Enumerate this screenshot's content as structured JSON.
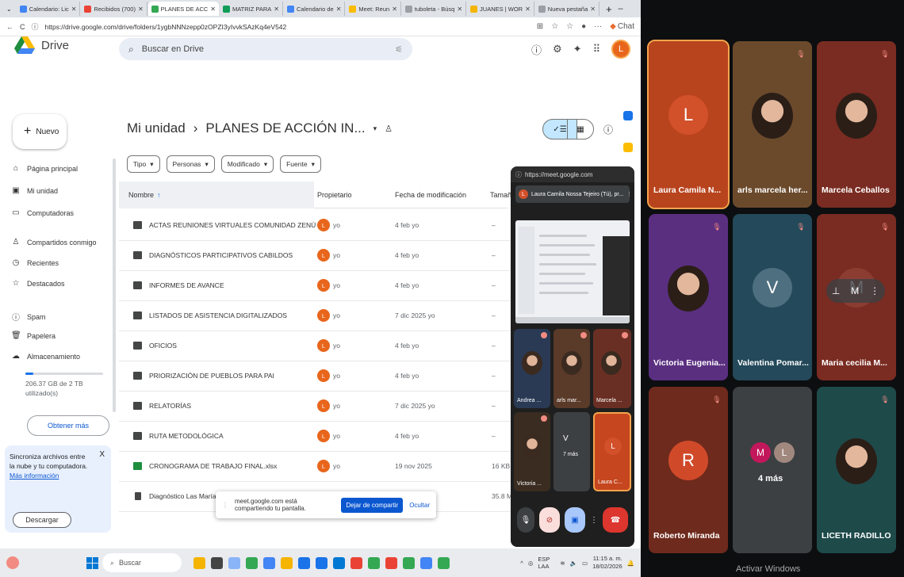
{
  "browser": {
    "tabs": [
      {
        "label": "Calendario: Lic",
        "color": "#4285f4"
      },
      {
        "label": "Recibidos (700)",
        "color": "#ea4335"
      },
      {
        "label": "PLANES DE ACC",
        "color": "#34a853",
        "active": true
      },
      {
        "label": "MATRIZ PARA",
        "color": "#0f9d58"
      },
      {
        "label": "Calendario de",
        "color": "#4285f4"
      },
      {
        "label": "Meet: Reun",
        "color": "#fbbc04"
      },
      {
        "label": "tuboleta - Búsq",
        "color": "#9aa0a6"
      },
      {
        "label": "JUANES | WOR",
        "color": "#f4b400"
      },
      {
        "label": "Nueva pestaña",
        "color": "#9aa0a6"
      }
    ],
    "new_tab": "+",
    "url": "https://drive.google.com/drive/folders/1ygbNNNzepp0zOPZI3yIvvkSAzKq4eV542",
    "chat_label": "Chat"
  },
  "drive": {
    "logo_text": "Drive",
    "search_placeholder": "Buscar en Drive",
    "new_button": "Nuevo",
    "sidebar": [
      {
        "label": "Página principal",
        "icon": "home-icon",
        "glyph": "⌂"
      },
      {
        "label": "Mi unidad",
        "icon": "drive-icon",
        "glyph": "▣"
      },
      {
        "label": "Computadoras",
        "icon": "computer-icon",
        "glyph": "▭"
      },
      {
        "label": "Compartidos conmigo",
        "icon": "shared-icon",
        "glyph": "♙"
      },
      {
        "label": "Recientes",
        "icon": "clock-icon",
        "glyph": "◷"
      },
      {
        "label": "Destacados",
        "icon": "star-icon",
        "glyph": "☆"
      },
      {
        "label": "Spam",
        "icon": "spam-icon",
        "glyph": "ⓘ"
      },
      {
        "label": "Papelera",
        "icon": "trash-icon",
        "glyph": "🗑"
      },
      {
        "label": "Almacenamiento",
        "icon": "cloud-icon",
        "glyph": "☁"
      }
    ],
    "storage_text": "206.37 GB de 2 TB utilizado(s)",
    "storage_fraction": 0.1,
    "obtener_mas": "Obtener más",
    "sync_card": {
      "text": "Sincroniza archivos entre la nube y tu computadora.",
      "more": "Más información",
      "download": "Descargar",
      "close": "X"
    },
    "breadcrumb": {
      "root": "Mi unidad",
      "separator": "›",
      "current": "PLANES DE ACCIÓN IN..."
    },
    "filters": [
      "Tipo",
      "Personas",
      "Modificado",
      "Fuente"
    ],
    "columns": {
      "name": "Nombre",
      "owner": "Propietario",
      "modified": "Fecha de modificación",
      "size": "Tamañ"
    },
    "rows": [
      {
        "name": "ACTAS REUNIONES VIRTUALES COMUNIDAD ZENÚ",
        "owner": "yo",
        "modified": "4 feb yo",
        "size": "–",
        "type": "folder"
      },
      {
        "name": "DIAGNÓSTICOS PARTICIPATIVOS CABILDOS",
        "owner": "yo",
        "modified": "4 feb yo",
        "size": "–",
        "type": "folder"
      },
      {
        "name": "INFORMES DE AVANCE",
        "owner": "yo",
        "modified": "4 feb yo",
        "size": "–",
        "type": "folder"
      },
      {
        "name": "LISTADOS DE ASISTENCIA DIGITALIZADOS",
        "owner": "yo",
        "modified": "7 dic 2025 yo",
        "size": "–",
        "type": "folder"
      },
      {
        "name": "OFICIOS",
        "owner": "yo",
        "modified": "4 feb yo",
        "size": "–",
        "type": "folder"
      },
      {
        "name": "PRIORIZACIÓN DE PUEBLOS PARA PAI",
        "owner": "yo",
        "modified": "4 feb yo",
        "size": "–",
        "type": "folder"
      },
      {
        "name": "RELATORÍAS",
        "owner": "yo",
        "modified": "7 dic 2025 yo",
        "size": "–",
        "type": "folder"
      },
      {
        "name": "RUTA METODOLÓGICA",
        "owner": "yo",
        "modified": "4 feb yo",
        "size": "–",
        "type": "folder"
      },
      {
        "name": "CRONOGRAMA DE TRABAJO FINAL.xlsx",
        "owner": "yo",
        "modified": "19 nov 2025",
        "size": "16 KB",
        "type": "xlsx"
      },
      {
        "name": "Diagnóstico Las Marías P",
        "owner": "",
        "modified": "",
        "size": "35.8 M",
        "type": "doc"
      }
    ],
    "owner_initial": "L",
    "share_bar": {
      "text": "meet.google.com está compartiendo tu pantalla.",
      "stop": "Dejar de compartir",
      "hide": "Ocultar"
    }
  },
  "pip": {
    "url": "https://meet.google.com",
    "presenter": "Laura Camila Nossa Tejeiro (Tú), pr...",
    "tiles": [
      "Andrea ...",
      "arls mar...",
      "Marcela ...",
      "Victoria ...",
      "7 más",
      "Laura C..."
    ],
    "more_initials": "V",
    "self_initial": "L"
  },
  "taskbar": {
    "search": "Buscar",
    "lang": "ESP LAA",
    "time": "11:15 a. m.",
    "date": "18/02/2026"
  },
  "meet_grid": [
    {
      "name": "Laura Camila N...",
      "initial": "L",
      "bg": "#b8441e",
      "avatar": "#d2502a",
      "face": false,
      "muted": false,
      "selected": true
    },
    {
      "name": "arls marcela her...",
      "initial": "",
      "bg": "#6b4a2c",
      "face": true,
      "muted": true
    },
    {
      "name": "Marcela Ceballos",
      "initial": "",
      "bg": "#7a2c22",
      "face": true,
      "muted": true
    },
    {
      "name": "Victoria Eugenia...",
      "initial": "",
      "bg": "#5a2f80",
      "face": true,
      "muted": true
    },
    {
      "name": "Valentina Pomar...",
      "initial": "V",
      "bg": "#23495a",
      "avatar": "#4d6f7f",
      "face": false,
      "muted": true
    },
    {
      "name": "Maria cecilia M...",
      "initial": "M",
      "bg": "#7a2c22",
      "avatar": "#8c3d32",
      "face": false,
      "muted": true,
      "controls": true
    },
    {
      "name": "Roberto Miranda",
      "initial": "R",
      "bg": "#6e2a1c",
      "avatar": "#d04a2a",
      "face": false,
      "muted": true
    },
    {
      "name": "4 más",
      "initial": "M L",
      "bg": "#3c4043",
      "face": false,
      "muted": false,
      "more": true
    },
    {
      "name": "LICETH RADILLO",
      "initial": "",
      "bg": "#1e4a4a",
      "face": true,
      "muted": true
    }
  ],
  "watermark": "Activar Windows"
}
